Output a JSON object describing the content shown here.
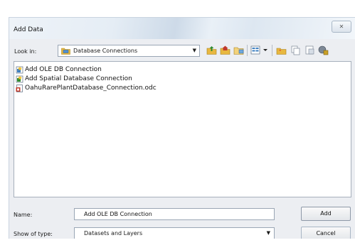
{
  "window": {
    "title": "Add Data",
    "close_glyph": "✕"
  },
  "look_in": {
    "label": "Look in:",
    "value": "Database Connections",
    "icon": "database-connections-folder-icon"
  },
  "toolbar": {
    "buttons": [
      "go-up-icon",
      "home-icon",
      "connect-folder-icon",
      "list-view-icon",
      "view-dropdown-icon",
      "new-folder-icon",
      "copy-icon",
      "catalog-icon",
      "toolboxes-icon"
    ]
  },
  "file_list": {
    "items": [
      {
        "label": "Add OLE DB Connection",
        "icon": "ole-db-connection-icon"
      },
      {
        "label": "Add Spatial Database Connection",
        "icon": "spatial-database-connection-icon"
      },
      {
        "label": "OahuRarePlantDatabase_Connection.odc",
        "icon": "odc-file-icon"
      }
    ]
  },
  "form": {
    "name_label": "Name:",
    "name_value": "Add OLE DB Connection",
    "type_label": "Show of type:",
    "type_value": "Datasets and Layers"
  },
  "buttons": {
    "add": "Add",
    "cancel": "Cancel"
  },
  "colors": {
    "accent": "#3d7fc1",
    "folder": "#e8b840"
  }
}
